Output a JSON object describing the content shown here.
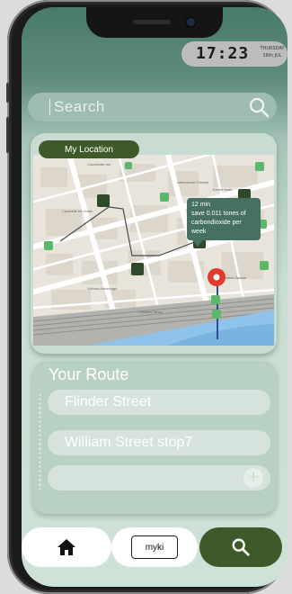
{
  "status": {
    "time": "17:23",
    "day": "THURSDAY",
    "date": "16th JUL"
  },
  "search": {
    "placeholder": "Search"
  },
  "map_card": {
    "location_button": "My Location",
    "info": {
      "line1": "12 min",
      "line2": "save 0.011 tones of",
      "line3": "carbondioxide per",
      "line4": "week"
    }
  },
  "route": {
    "title": "Your Route",
    "stops": [
      "Flinder Street",
      "William Street stop7",
      ""
    ],
    "add_icon": "plus-icon"
  },
  "tabbar": {
    "home_icon": "home-icon",
    "myki_label": "myki",
    "search_icon": "search-icon"
  },
  "colors": {
    "accent_dark": "#3e5a2a",
    "popup": "#46705f",
    "card": "#c9dcd2"
  }
}
